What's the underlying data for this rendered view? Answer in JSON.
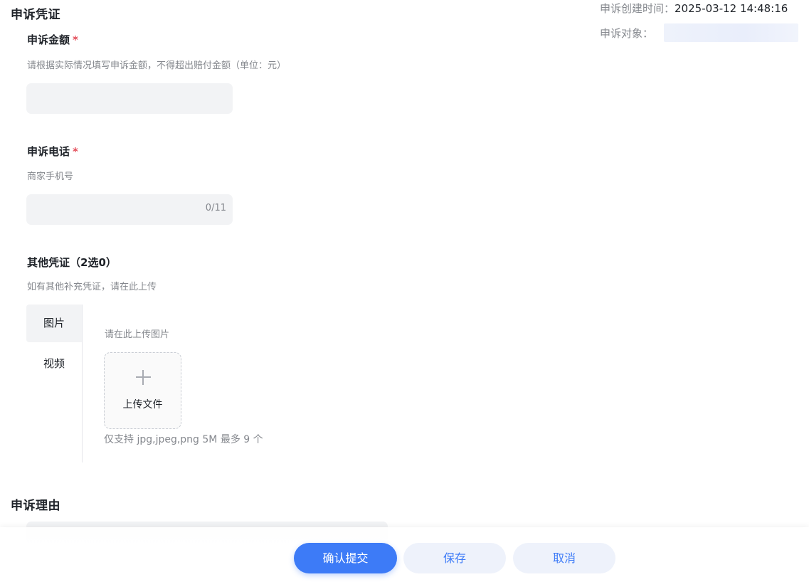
{
  "evidence_section": {
    "title": "申诉凭证"
  },
  "meta": {
    "created_label": "申诉创建时间：",
    "created_value": "2025-03-12 14:48:16",
    "object_label": "申诉对象："
  },
  "amount_field": {
    "label": "申诉金额",
    "required_mark": "*",
    "hint": "请根据实际情况填写申诉金额，不得超出赔付金额（单位：元）",
    "value": ""
  },
  "phone_field": {
    "label": "申诉电话",
    "required_mark": "*",
    "hint": "商家手机号",
    "value": "",
    "counter": "0/11"
  },
  "other_evidence": {
    "label": "其他凭证（2选0）",
    "hint": "如有其他补充凭证，请在此上传",
    "tabs": [
      {
        "label": "图片",
        "active": true
      },
      {
        "label": "视频",
        "active": false
      }
    ],
    "upload_hint": "请在此上传图片",
    "upload_button_label": "上传文件",
    "upload_note": "仅支持 jpg,jpeg,png 5M 最多 9 个"
  },
  "reason_section": {
    "title": "申诉理由"
  },
  "footer": {
    "submit_label": "确认提交",
    "save_label": "保存",
    "cancel_label": "取消"
  },
  "colors": {
    "primary": "#3d7bf7",
    "required": "#e34d59",
    "input_bg": "#f2f3f5",
    "secondary_btn_bg": "#eef2fb"
  }
}
